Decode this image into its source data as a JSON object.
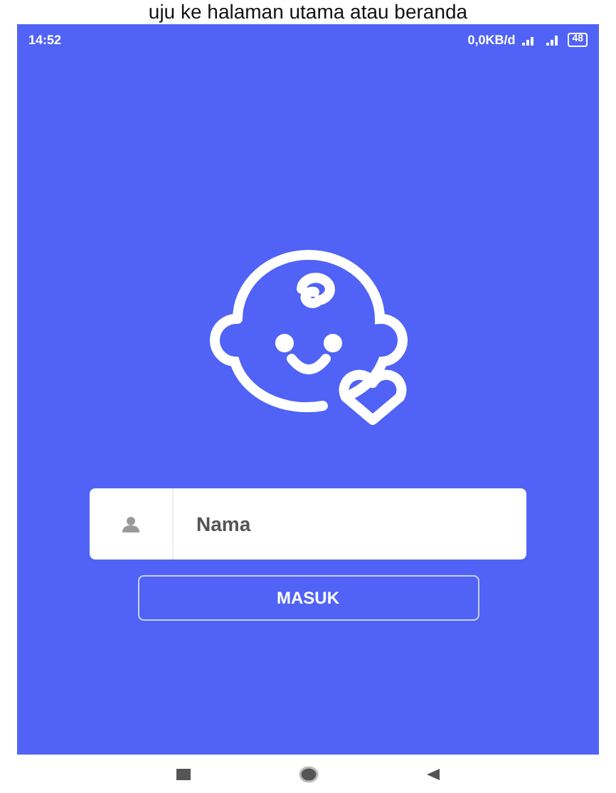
{
  "caption": "uju ke halaman utama atau beranda",
  "status_bar": {
    "time": "14:52",
    "speed": "0,0KB/d",
    "battery": "48"
  },
  "login": {
    "name_field": {
      "placeholder": "Nama"
    },
    "button": "MASUK"
  }
}
